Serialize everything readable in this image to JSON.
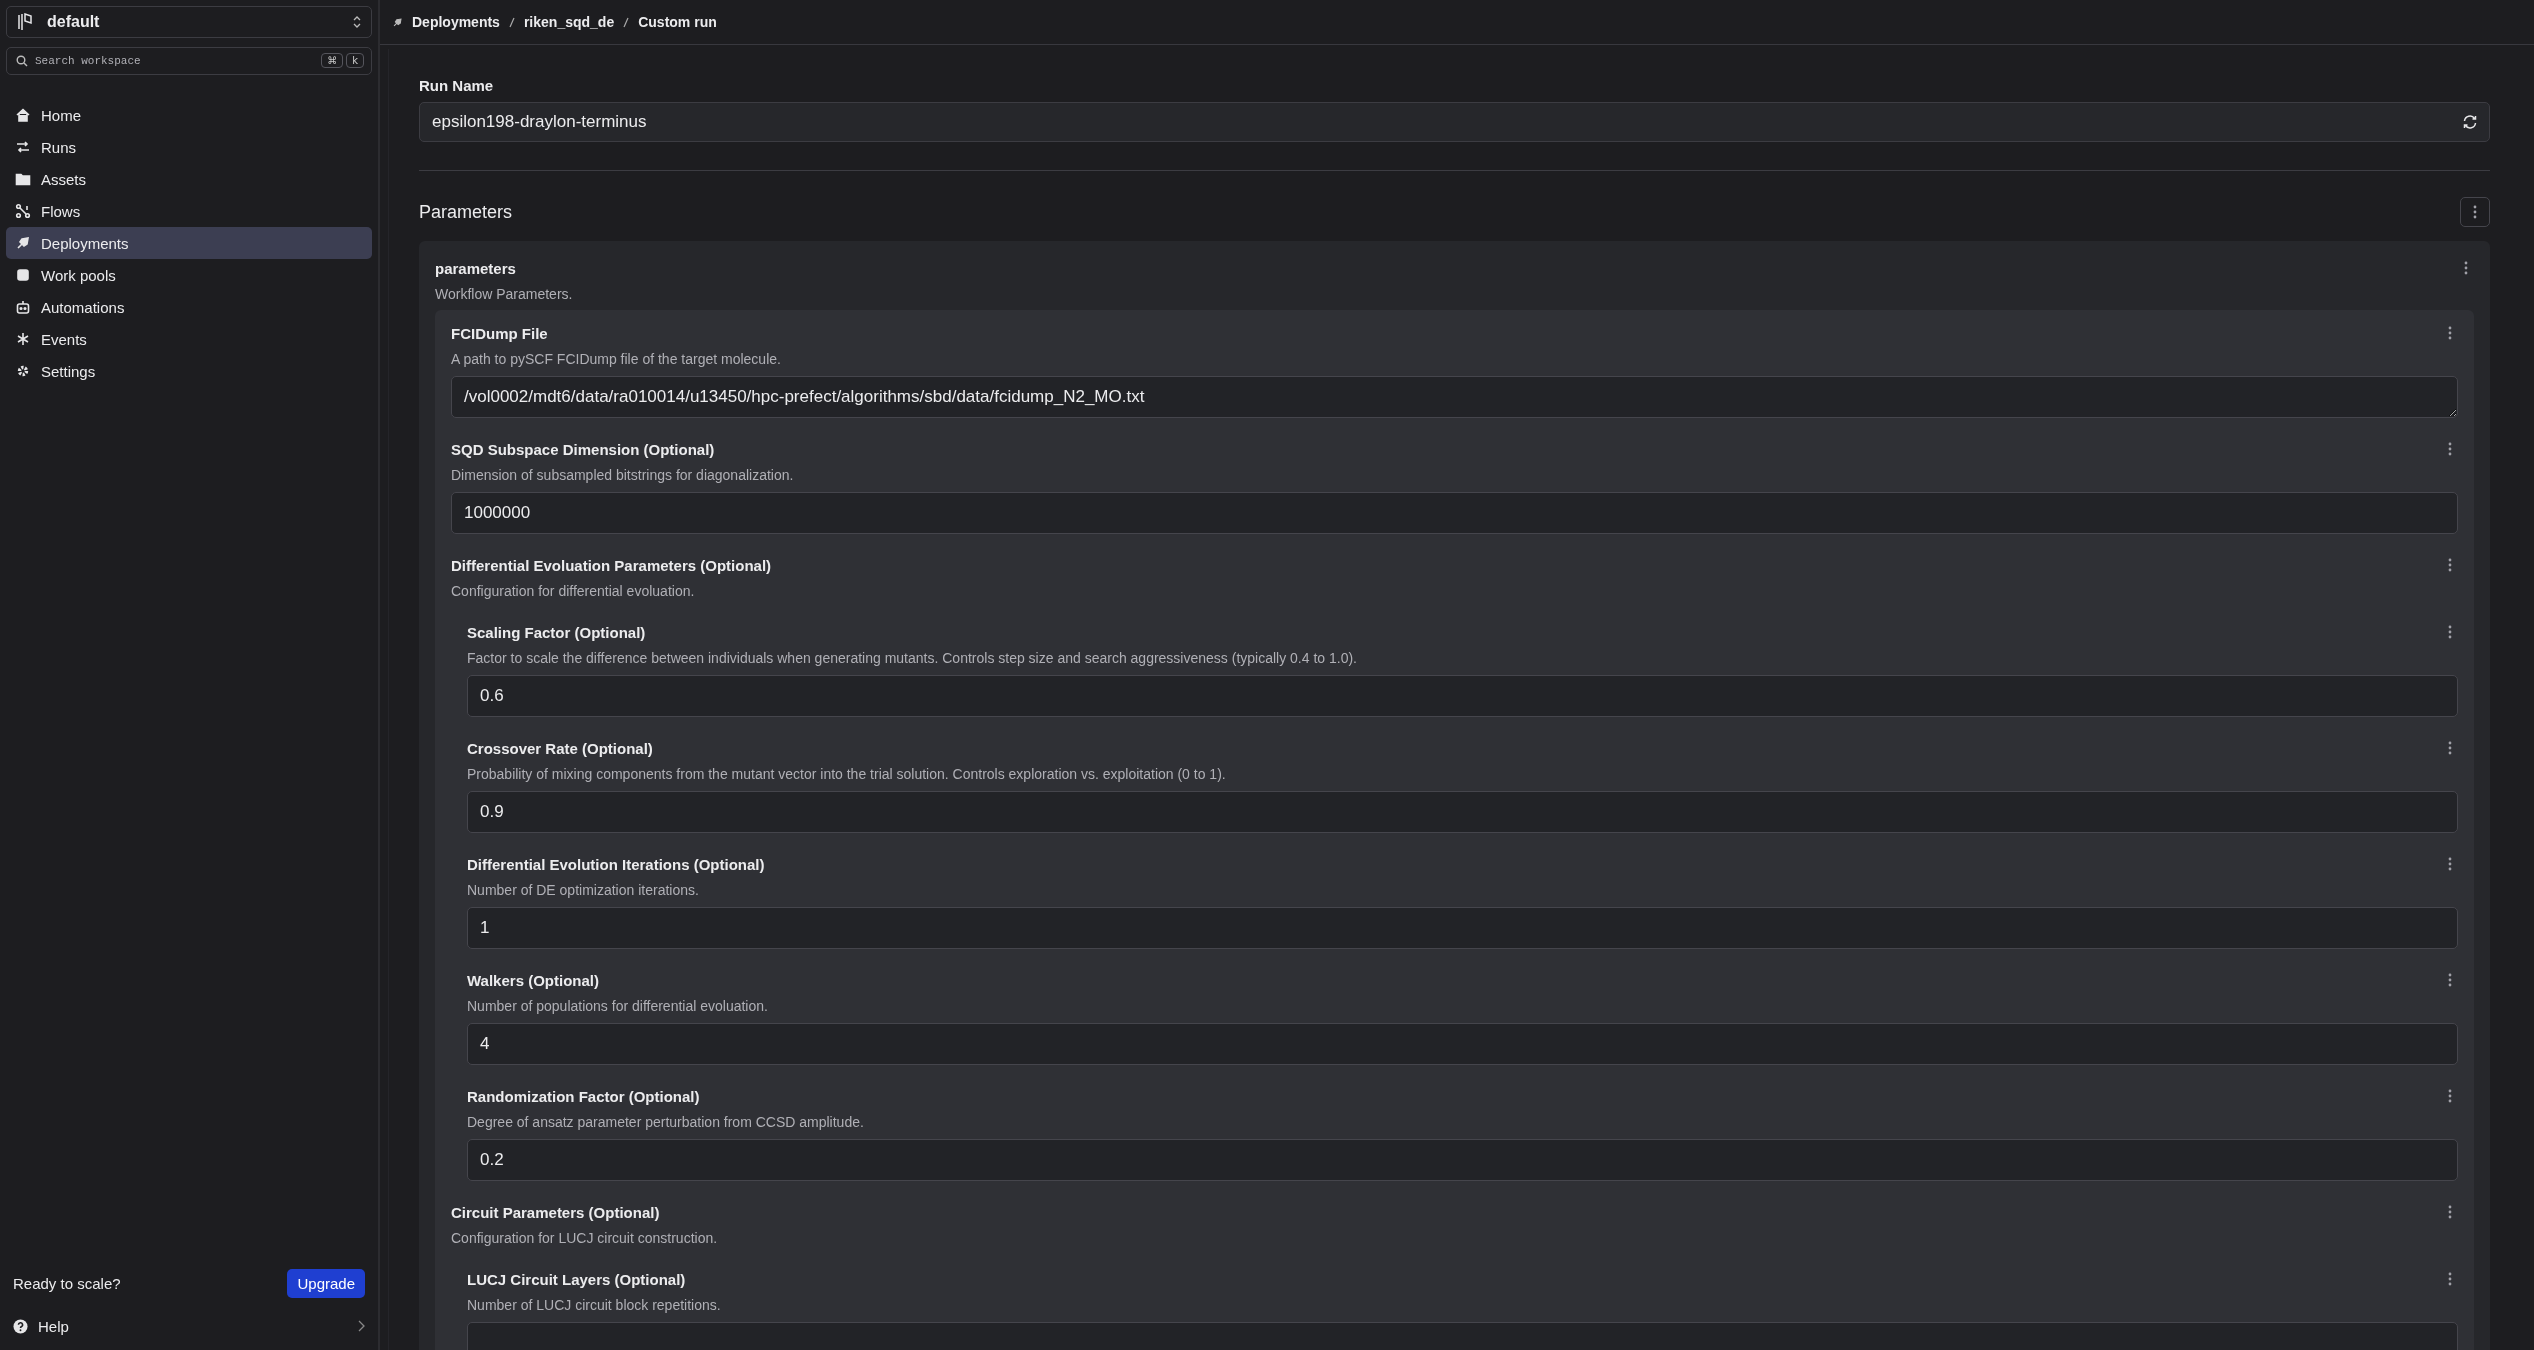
{
  "workspace": {
    "name": "default"
  },
  "search": {
    "placeholder": "Search workspace",
    "keys": [
      "⌘",
      "k"
    ]
  },
  "nav": [
    {
      "label": "Home",
      "selected": false
    },
    {
      "label": "Runs",
      "selected": false
    },
    {
      "label": "Assets",
      "selected": false
    },
    {
      "label": "Flows",
      "selected": false
    },
    {
      "label": "Deployments",
      "selected": true
    },
    {
      "label": "Work pools",
      "selected": false
    },
    {
      "label": "Automations",
      "selected": false
    },
    {
      "label": "Events",
      "selected": false
    },
    {
      "label": "Settings",
      "selected": false
    }
  ],
  "upgrade": {
    "text": "Ready to scale?",
    "button": "Upgrade"
  },
  "help": {
    "label": "Help"
  },
  "breadcrumb": [
    "Deployments",
    "riken_sqd_de",
    "Custom run"
  ],
  "run_name": {
    "label": "Run Name",
    "value": "epsilon198-draylon-terminus"
  },
  "parameters": {
    "title": "Parameters",
    "group": {
      "name": "parameters",
      "description": "Workflow Parameters.",
      "fields": [
        {
          "kind": "textarea",
          "label": "FCIDump File",
          "description": "A path to pySCF FCIDump file of the target molecule.",
          "value": "/vol0002/mdt6/data/ra010014/u13450/hpc-prefect/algorithms/sbd/data/fcidump_N2_MO.txt"
        },
        {
          "kind": "input",
          "label": "SQD Subspace Dimension (Optional)",
          "description": "Dimension of subsampled bitstrings for diagonalization.",
          "value": "1000000"
        },
        {
          "kind": "group",
          "label": "Differential Evoluation Parameters (Optional)",
          "description": "Configuration for differential evoluation.",
          "children": [
            {
              "kind": "input",
              "label": "Scaling Factor (Optional)",
              "description": "Factor to scale the difference between individuals when generating mutants. Controls step size and search aggressiveness (typically 0.4 to 1.0).",
              "value": "0.6"
            },
            {
              "kind": "input",
              "label": "Crossover Rate (Optional)",
              "description": "Probability of mixing components from the mutant vector into the trial solution. Controls exploration vs. exploitation (0 to 1).",
              "value": "0.9"
            },
            {
              "kind": "input",
              "label": "Differential Evolution Iterations (Optional)",
              "description": "Number of DE optimization iterations.",
              "value": "1"
            },
            {
              "kind": "input",
              "label": "Walkers (Optional)",
              "description": "Number of populations for differential evoluation.",
              "value": "4"
            },
            {
              "kind": "input",
              "label": "Randomization Factor (Optional)",
              "description": "Degree of ansatz parameter perturbation from CCSD amplitude.",
              "value": "0.2"
            }
          ]
        },
        {
          "kind": "group",
          "label": "Circuit Parameters (Optional)",
          "description": "Configuration for LUCJ circuit construction.",
          "children": [
            {
              "kind": "input",
              "label": "LUCJ Circuit Layers (Optional)",
              "description": "Number of LUCJ circuit block repetitions."
            }
          ]
        }
      ]
    }
  }
}
